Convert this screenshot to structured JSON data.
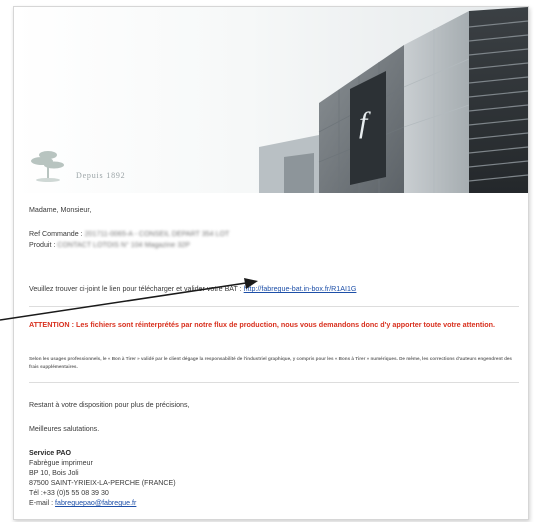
{
  "header": {
    "tagline": "Depuis 1892",
    "building_sign": "fabrègue"
  },
  "email": {
    "greeting": "Madame, Monsieur,",
    "order_ref_label": "Ref Commande :",
    "order_ref_value": "201711-0065-A - CONSEIL DEPART 354 LOT",
    "product_label": "Produit :",
    "product_value": "CONTACT LOTOIS N° 104 Magazine 32P",
    "bat_text": "Veuillez trouver ci-joint le lien pour télécharger et valider votre BAT :",
    "bat_link": "http://fabregue-bat.in-box.fr/R1AI1G",
    "attention": "ATTENTION : Les fichiers sont réinterprétés par notre flux de production, nous vous demandons donc d'y apporter toute votre attention.",
    "legal": "Selon les usages professionnels, le « Bon à Tirer » validé par le client dégage la responsabilité de l'industriel graphique, y compris pour les « Bons à Tirer » numériques. De même, les corrections d'auteurs engendrent des frais supplémentaires.",
    "availability": "Restant à votre disposition pour plus de précisions,",
    "closing": "Meilleures salutations."
  },
  "signature": {
    "title": "Service PAO",
    "company": "Fabrègue imprimeur",
    "address1": "BP 10, Bois Joli",
    "address2": "87500 SAINT-YRIEIX-LA-PERCHE (FRANCE)",
    "phone": "Tél :+33 (0)5 55 08 39 30",
    "email_label": "E-mail :",
    "email_value": "fabreguepao@fabregue.fr"
  }
}
